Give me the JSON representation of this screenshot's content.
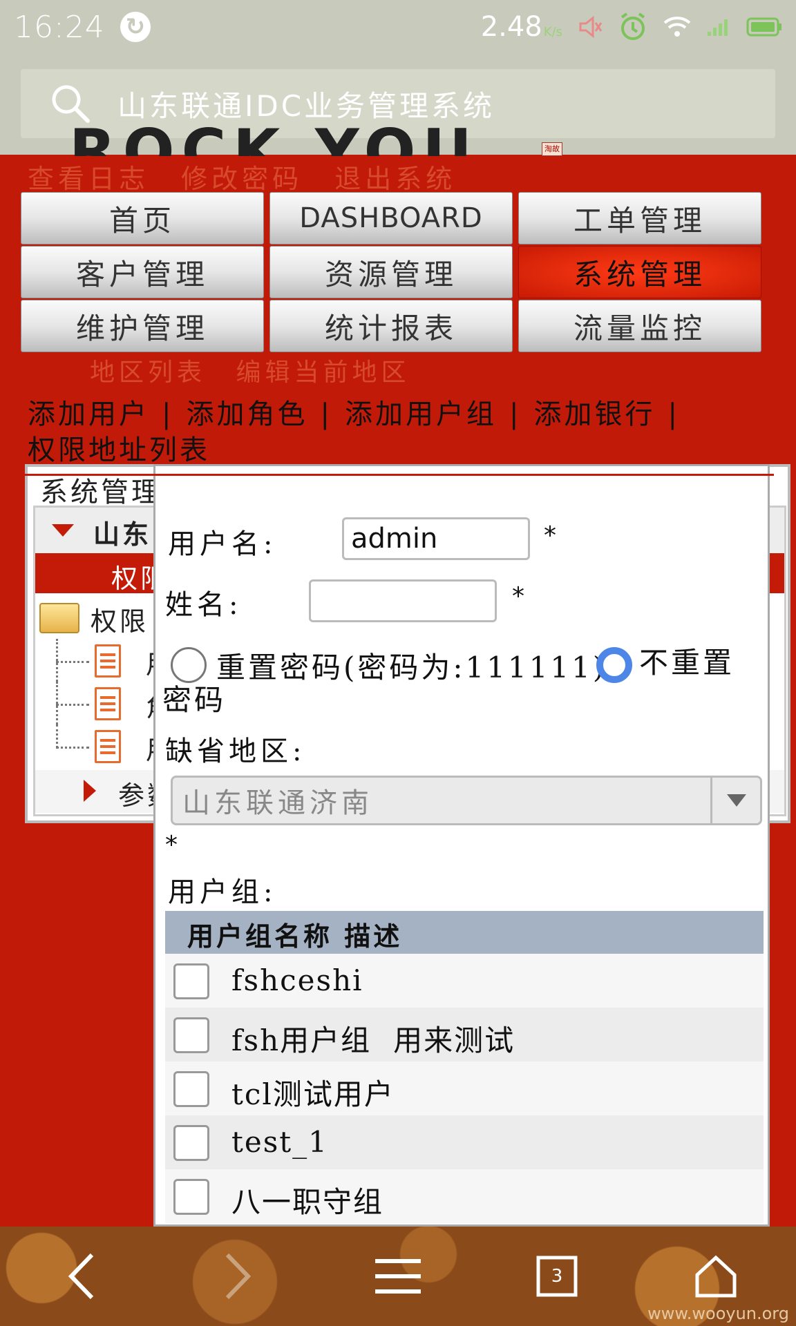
{
  "status_bar": {
    "time": "16:24",
    "net_speed": "2.48",
    "net_speed_unit": "K/s"
  },
  "browser": {
    "address_text": "山东联通IDC业务管理系统"
  },
  "header": {
    "logo_text": "ROCK YOU",
    "taobao_badge": "淘故",
    "top_links": [
      "查看日志",
      "修改密码",
      "退出系统"
    ]
  },
  "menu": {
    "items": [
      {
        "label": "首页"
      },
      {
        "label": "DASHBOARD"
      },
      {
        "label": "工单管理"
      },
      {
        "label": "客户管理"
      },
      {
        "label": "资源管理"
      },
      {
        "label": "系统管理"
      },
      {
        "label": "维护管理"
      },
      {
        "label": "统计报表"
      },
      {
        "label": "流量监控"
      }
    ],
    "active": "系统管理"
  },
  "sub_links": [
    "地区列表",
    "编辑当前地区"
  ],
  "actions": {
    "items": [
      "添加用户",
      "添加角色",
      "添加用户组",
      "添加银行",
      "权限地址列表"
    ],
    "separator": "|"
  },
  "tree_panel": {
    "title": "系统管理修改用户资料",
    "root": "山东",
    "selected": "权限",
    "folder": "权限",
    "files": [
      "用",
      "角",
      "用"
    ],
    "param": "参数"
  },
  "form": {
    "username_label": "用户名:",
    "username_value": "admin",
    "name_label": "姓名:",
    "name_value": "",
    "required_mark": "*",
    "radio_reset_label": "重置密码(密码为:111111)",
    "radio_noreset_label": "不重置密码",
    "region_label": "缺省地区:",
    "region_value": "山东联通济南",
    "group_label": "用户组:",
    "group_table": {
      "header": "用户组名称 描述",
      "rows": [
        {
          "name": "fshceshi",
          "desc": ""
        },
        {
          "name": "fsh用户组",
          "desc": "用来测试"
        },
        {
          "name": "tcl测试用户",
          "desc": ""
        },
        {
          "name": "test_1",
          "desc": ""
        },
        {
          "name": "八一职守组",
          "desc": ""
        }
      ]
    }
  },
  "nav_bar": {
    "tab_count": "3"
  },
  "watermark": "www.wooyun.org",
  "colors": {
    "page_bg": "#c21a08",
    "active_menu": "#e12a0c",
    "radio_selected": "#4e86e8",
    "status_bar_bg": "#c8cabb"
  }
}
